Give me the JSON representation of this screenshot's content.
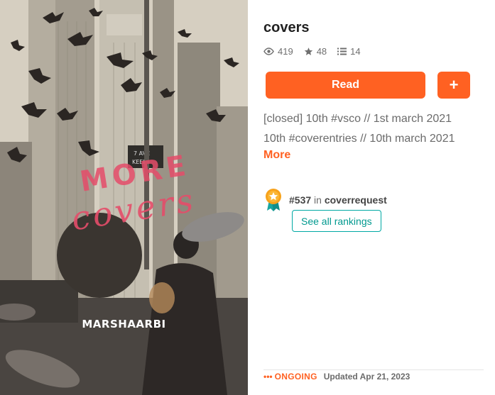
{
  "story": {
    "title": "covers",
    "stats": {
      "reads": "419",
      "votes": "48",
      "parts": "14"
    },
    "read_label": "Read",
    "add_label": "+",
    "description_lines": [
      "[closed] 10th #vsco // 1st march 2021",
      "10th #coverentries // 10th march 2021"
    ],
    "more_label": "More"
  },
  "ranking": {
    "rank": "#537",
    "in": "in",
    "tag": "coverrequest",
    "see_all_label": "See all rankings"
  },
  "status": {
    "dots": "•••",
    "state": "ONGOING",
    "updated": "Updated Apr 21, 2023"
  },
  "cover": {
    "title_line1": "MORE",
    "title_line2": "covers",
    "author": "MARSHAARBI"
  },
  "colors": {
    "accent": "#ff6122",
    "teal": "#00a9a4",
    "cover_text": "#e54d6a"
  }
}
